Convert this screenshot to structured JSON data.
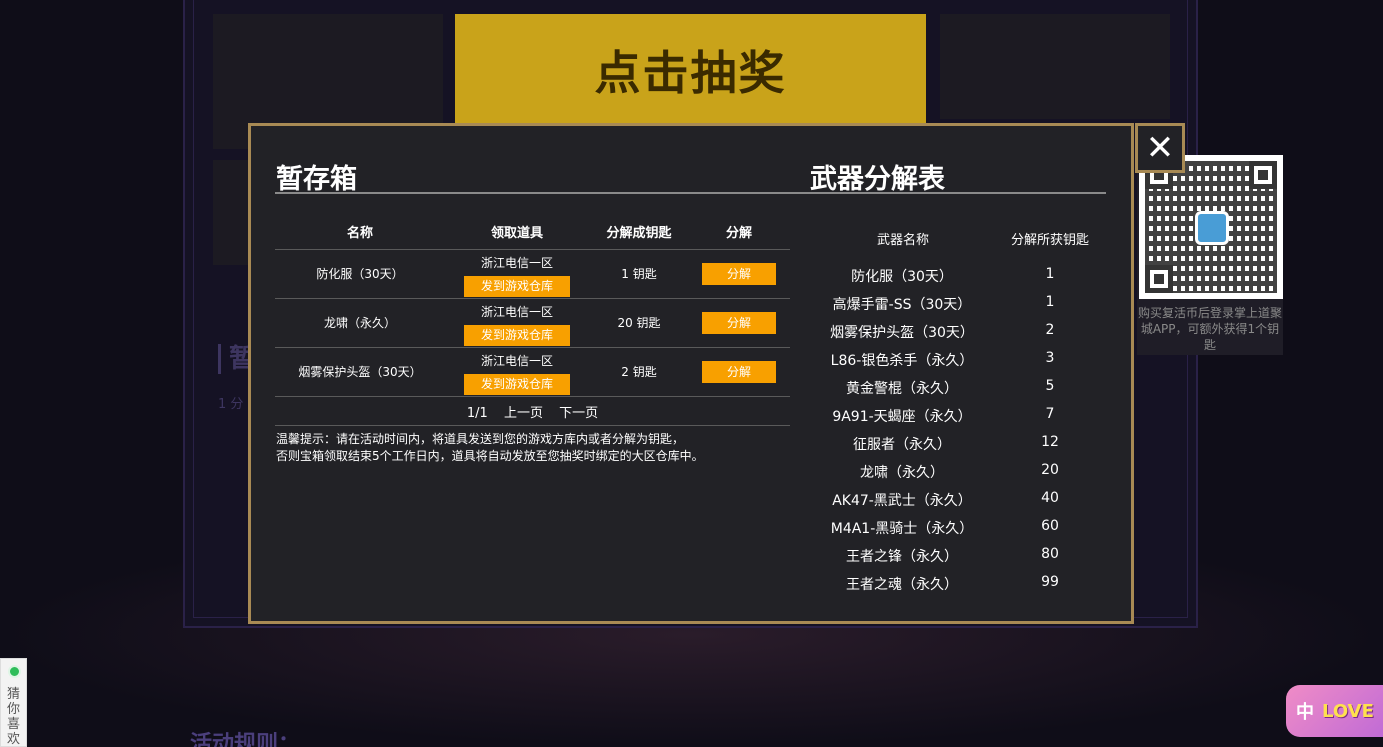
{
  "background": {
    "draw_button_label": "点击抽奖",
    "side_title": "暂存箱",
    "side_sub": "1 分",
    "rules_title": "活动规则："
  },
  "qr": {
    "caption": "购买复活币后登录掌上道聚城APP，可额外获得1个钥匙"
  },
  "guess_widget": {
    "label": "猜你喜欢"
  },
  "love_badge": {
    "zh": "中",
    "word": "LOVE"
  },
  "modal": {
    "close_label": "✕",
    "storage": {
      "title": "暂存箱",
      "columns": [
        "名称",
        "领取道具",
        "分解成钥匙",
        "分解"
      ],
      "rows": [
        {
          "name": "防化服（30天）",
          "region": "浙江电信一区",
          "send_label": "发到游戏仓库",
          "keys": "1 钥匙",
          "decompose_label": "分解"
        },
        {
          "name": "龙啸（永久）",
          "region": "浙江电信一区",
          "send_label": "发到游戏仓库",
          "keys": "20 钥匙",
          "decompose_label": "分解"
        },
        {
          "name": "烟雾保护头盔（30天）",
          "region": "浙江电信一区",
          "send_label": "发到游戏仓库",
          "keys": "2 钥匙",
          "decompose_label": "分解"
        }
      ],
      "pager": {
        "page": "1/1",
        "prev": "上一页",
        "next": "下一页"
      },
      "tip_line1": "温馨提示：请在活动时间内，将道具发送到您的游戏方库内或者分解为钥匙，",
      "tip_line2": "否则宝箱领取结束5个工作日内，道具将自动发放至您抽奖时绑定的大区仓库中。"
    },
    "weapons": {
      "title": "武器分解表",
      "columns": [
        "武器名称",
        "分解所获钥匙"
      ],
      "rows": [
        {
          "name": "防化服（30天）",
          "keys": "1"
        },
        {
          "name": "高爆手雷-SS（30天）",
          "keys": "1"
        },
        {
          "name": "烟雾保护头盔（30天）",
          "keys": "2"
        },
        {
          "name": "L86-银色杀手（永久）",
          "keys": "3"
        },
        {
          "name": "黄金警棍（永久）",
          "keys": "5"
        },
        {
          "name": "9A91-天蝎座（永久）",
          "keys": "7"
        },
        {
          "name": "征服者（永久）",
          "keys": "12"
        },
        {
          "name": "龙啸（永久）",
          "keys": "20"
        },
        {
          "name": "AK47-黑武士（永久）",
          "keys": "40"
        },
        {
          "name": "M4A1-黑骑士（永久）",
          "keys": "60"
        },
        {
          "name": "王者之锋（永久）",
          "keys": "80"
        },
        {
          "name": "王者之魂（永久）",
          "keys": "99"
        }
      ]
    }
  },
  "colors": {
    "accent_orange": "#f8a000",
    "modal_border": "#a88a54",
    "modal_bg": "#222226"
  }
}
